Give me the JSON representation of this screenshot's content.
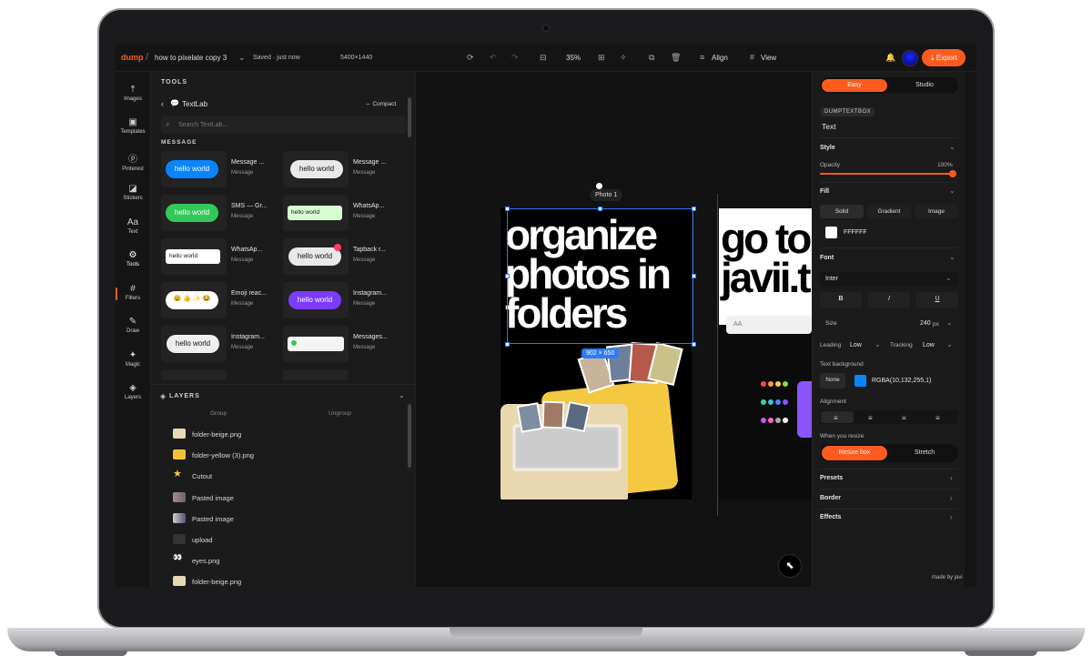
{
  "topbar": {
    "logo": "dump",
    "doc_title": "how to pixelate copy 3",
    "saved": "Saved · just now",
    "dimensions": "5400×1440",
    "zoom": "35%",
    "align": "Align",
    "view": "View",
    "export": "Export"
  },
  "rail": [
    {
      "label": "Images",
      "icon": "upload-icon"
    },
    {
      "label": "Templates",
      "icon": "templates-icon"
    },
    {
      "label": "Pinterest",
      "icon": "pinterest-icon"
    },
    {
      "label": "Stickers",
      "icon": "stickers-icon"
    },
    {
      "label": "Text",
      "icon": "text-icon"
    },
    {
      "label": "Tools",
      "icon": "tools-icon"
    },
    {
      "label": "Filters",
      "icon": "filters-icon"
    },
    {
      "label": "Draw",
      "icon": "draw-icon"
    },
    {
      "label": "Magic",
      "icon": "magic-icon"
    },
    {
      "label": "Layers",
      "icon": "layers-icon"
    }
  ],
  "tools": {
    "label": "TOOLS",
    "textlab": "TextLab",
    "compact": "Compact",
    "search_placeholder": "Search TextLab...",
    "section": "MESSAGE",
    "cards": [
      {
        "title": "Message ...",
        "sub": "Message",
        "bubble": "hello world"
      },
      {
        "title": "Message ...",
        "sub": "Message",
        "bubble": "hello world"
      },
      {
        "title": "SMS — Gr...",
        "sub": "Message",
        "bubble": "hello world"
      },
      {
        "title": "WhatsAp...",
        "sub": "Message",
        "bubble": "hello world"
      },
      {
        "title": "WhatsAp...",
        "sub": "Message",
        "bubble": "hello world"
      },
      {
        "title": "Tapback r...",
        "sub": "Message",
        "bubble": "hello world"
      },
      {
        "title": "Emoji reac...",
        "sub": "Message",
        "bubble": ""
      },
      {
        "title": "Instagram...",
        "sub": "Message",
        "bubble": "hello world"
      },
      {
        "title": "Instagram...",
        "sub": "Message",
        "bubble": "hello world"
      },
      {
        "title": "Messages...",
        "sub": "Message",
        "bubble": ""
      }
    ]
  },
  "layers": {
    "label": "LAYERS",
    "group": "Group",
    "ungroup": "Ungroup",
    "items": [
      "folder-beige.png",
      "folder-yellow (3).png",
      "Cutout",
      "Pasted image",
      "Pasted image",
      "upload",
      "eyes.png",
      "folder-beige.png"
    ]
  },
  "canvas": {
    "photo_label": "Photo 1",
    "size_badge": "902 × 650",
    "headline": "organize photos in folders",
    "headline2": "go to javii.t",
    "search_hint": "AA"
  },
  "panel": {
    "mode_easy": "Easy",
    "mode_studio": "Studio",
    "tag": "DUMPTEXTBOX",
    "element": "Text",
    "style": "Style",
    "opacity_label": "Opacity",
    "opacity_value": "100%",
    "opacity": 1.0,
    "fill": "Fill",
    "fill_tabs": [
      "Solid",
      "Gradient",
      "Image"
    ],
    "fill_hex": "FFFFFF",
    "font": "Font",
    "font_family": "Inter",
    "bold": "B",
    "italic": "I",
    "underline": "U",
    "size_label": "Size",
    "size_value": "240",
    "size_unit": "px",
    "leading_label": "Leading",
    "leading_value": "Low",
    "tracking_label": "Tracking",
    "tracking_value": "Low",
    "text_bg": "Text background",
    "none": "None",
    "bg_color": "RGBA(10,132,255,1)",
    "alignment": "Alignment",
    "when_resize": "When you resize",
    "resize_box": "Resize box",
    "stretch": "Stretch",
    "presets": "Presets",
    "border": "Border",
    "effects": "Effects",
    "credit": "made by javi"
  },
  "colors": {
    "accent": "#ff5b1f",
    "selection": "#2d7cf6",
    "imessage_blue": "#0a84ff"
  }
}
